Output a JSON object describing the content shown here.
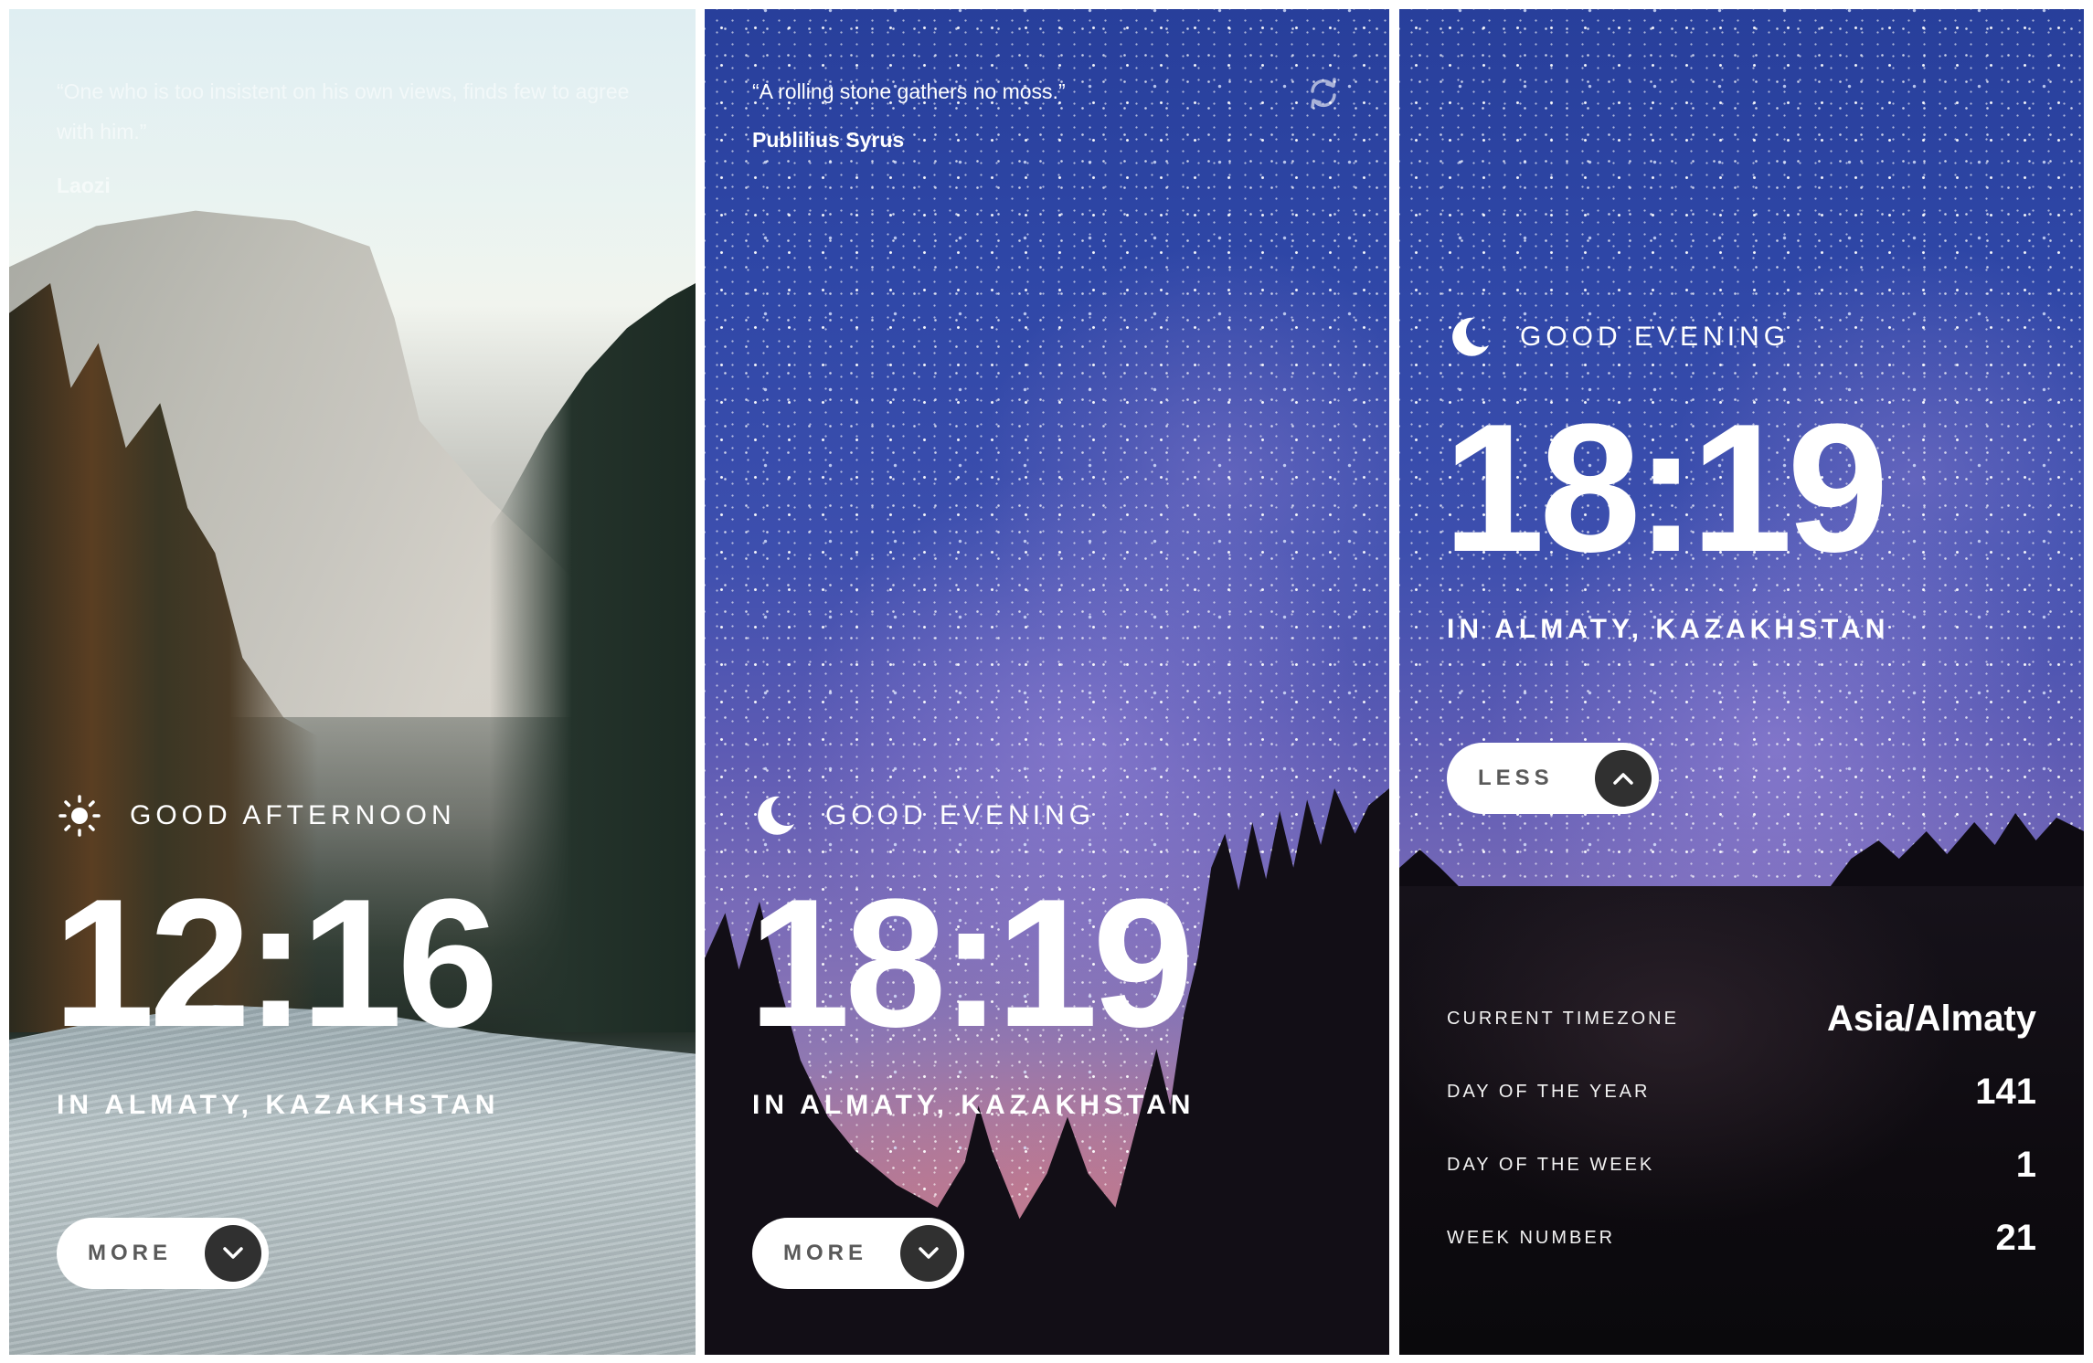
{
  "panels": [
    {
      "quote": "“One who is too insistent on his own views, finds few to agree with him.”",
      "author": "Laozi",
      "greeting": "GOOD AFTERNOON",
      "greeting_icon": "sun-icon",
      "time": "12:16",
      "location": "IN ALMATY, KAZAKHSTAN",
      "toggle_label": "MORE",
      "toggle_icon": "chevron-down-icon"
    },
    {
      "quote": "“A rolling stone gathers no moss.”",
      "author": "Publilius Syrus",
      "refresh_icon": "refresh-icon",
      "greeting": "GOOD EVENING",
      "greeting_icon": "moon-icon",
      "time": "18:19",
      "location": "IN ALMATY, KAZAKHSTAN",
      "toggle_label": "MORE",
      "toggle_icon": "chevron-down-icon"
    },
    {
      "greeting": "GOOD EVENING",
      "greeting_icon": "moon-icon",
      "time": "18:19",
      "location": "IN ALMATY, KAZAKHSTAN",
      "toggle_label": "LESS",
      "toggle_icon": "chevron-up-icon",
      "details": [
        {
          "label": "CURRENT TIMEZONE",
          "value": "Asia/Almaty"
        },
        {
          "label": "DAY OF THE YEAR",
          "value": "141"
        },
        {
          "label": "DAY OF THE WEEK",
          "value": "1"
        },
        {
          "label": "WEEK NUMBER",
          "value": "21"
        }
      ]
    }
  ],
  "colors": {
    "button_bg": "#ffffff",
    "button_text": "#5a5a5a",
    "button_circle": "#303030",
    "text": "#ffffff",
    "drawer_bg": "#0e0b10"
  }
}
